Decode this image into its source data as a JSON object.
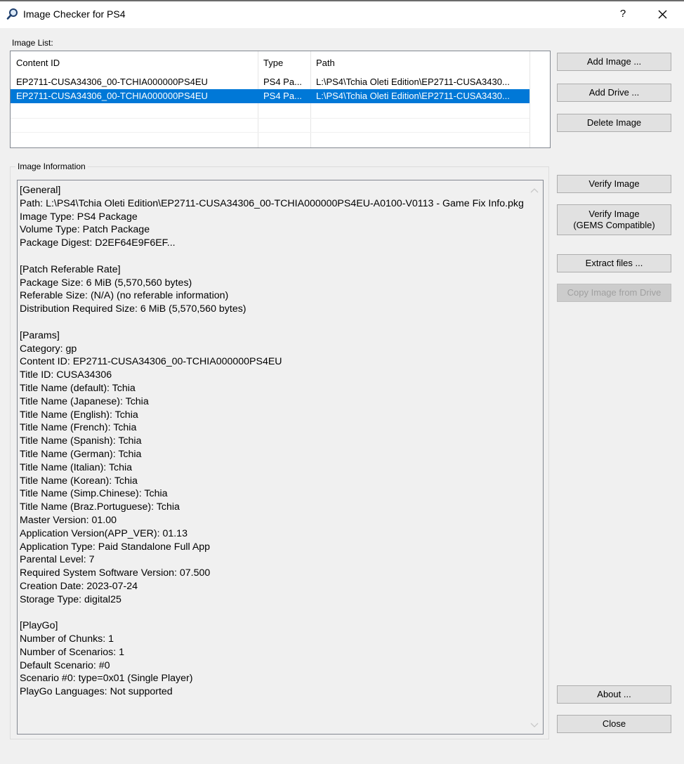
{
  "window": {
    "title": "Image Checker for PS4",
    "help_label": "?"
  },
  "image_list": {
    "label": "Image List:",
    "columns": [
      "Content ID",
      "Type",
      "Path"
    ],
    "rows": [
      {
        "content_id": "EP2711-CUSA34306_00-TCHIA000000PS4EU",
        "type": "PS4 Pa...",
        "path": "L:\\PS4\\Tchia Oleti Edition\\EP2711-CUSA3430...",
        "selected": false
      },
      {
        "content_id": "EP2711-CUSA34306_00-TCHIA000000PS4EU",
        "type": "PS4 Pa...",
        "path": "L:\\PS4\\Tchia Oleti Edition\\EP2711-CUSA3430...",
        "selected": true
      }
    ]
  },
  "buttons": {
    "add_image": "Add Image ...",
    "add_drive": "Add Drive ...",
    "delete_image": "Delete Image",
    "verify_image": "Verify Image",
    "verify_gems_line1": "Verify Image",
    "verify_gems_line2": "(GEMS Compatible)",
    "extract_files": "Extract files ...",
    "copy_from_drive": "Copy Image from Drive",
    "about": "About ...",
    "close": "Close"
  },
  "image_information": {
    "label": "Image Information",
    "text": "[General]\nPath: L:\\PS4\\Tchia Oleti Edition\\EP2711-CUSA34306_00-TCHIA000000PS4EU-A0100-V0113 - Game Fix Info.pkg\nImage Type: PS4 Package\nVolume Type: Patch Package\nPackage Digest: D2EF64E9F6EF...\n\n[Patch Referable Rate]\nPackage Size: 6 MiB (5,570,560 bytes)\nReferable Size: (N/A) (no referable information)\nDistribution Required Size: 6 MiB (5,570,560 bytes)\n\n[Params]\nCategory: gp\nContent ID: EP2711-CUSA34306_00-TCHIA000000PS4EU\nTitle ID: CUSA34306\nTitle Name (default): Tchia\nTitle Name (Japanese): Tchia\nTitle Name (English): Tchia\nTitle Name (French): Tchia\nTitle Name (Spanish): Tchia\nTitle Name (German): Tchia\nTitle Name (Italian): Tchia\nTitle Name (Korean): Tchia\nTitle Name (Simp.Chinese): Tchia\nTitle Name (Braz.Portuguese): Tchia\nMaster Version: 01.00\nApplication Version(APP_VER): 01.13\nApplication Type: Paid Standalone Full App\nParental Level: 7\nRequired System Software Version: 07.500\nCreation Date: 2023-07-24\nStorage Type: digital25\n\n[PlayGo]\nNumber of Chunks: 1\nNumber of Scenarios: 1\nDefault Scenario: #0\nScenario #0: type=0x01 (Single Player)\nPlayGo Languages: Not supported"
  },
  "colors": {
    "selection": "#0078d7",
    "window_bg": "#f0f0f0",
    "button_bg": "#e1e1e1"
  }
}
